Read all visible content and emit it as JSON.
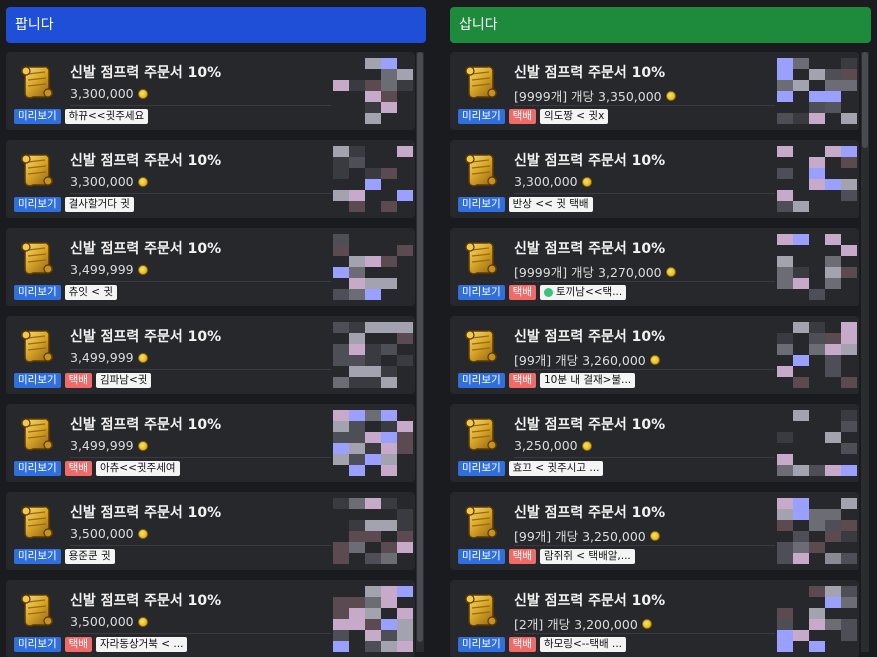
{
  "item_title": "신발 점프력 주문서 10%",
  "preview_label": "미리보기",
  "delivery_label": "택배",
  "sell": {
    "header": "팝니다",
    "listings": [
      {
        "price": "3,300,000",
        "seller": "하뀨<<귓주세요",
        "delivery": false
      },
      {
        "price": "3,300,000",
        "seller": "결사할거다 귓",
        "delivery": false
      },
      {
        "price": "3,499,999",
        "seller": "츄잇 < 귓",
        "delivery": false
      },
      {
        "price": "3,499,999",
        "seller": "김파남<귓",
        "delivery": true
      },
      {
        "price": "3,499,999",
        "seller": "아츄<<귓주세여",
        "delivery": true
      },
      {
        "price": "3,500,000",
        "seller": "용준쿤 귓",
        "delivery": false
      },
      {
        "price": "3,500,000",
        "seller": "자라동상거북 < ...",
        "delivery": true
      }
    ]
  },
  "buy": {
    "header": "삽니다",
    "listings": [
      {
        "price": "[9999개] 개당 3,350,000",
        "seller": "의도짱 < 귓x",
        "delivery": true,
        "gem": false
      },
      {
        "price": "3,300,000",
        "seller": "반상 << 귓 택배",
        "delivery": false,
        "gem": false
      },
      {
        "price": "[9999개] 개당 3,270,000",
        "seller": "토끼남<<택...",
        "delivery": true,
        "gem": true
      },
      {
        "price": "[99개] 개당 3,260,000",
        "seller": "10분 내 결재>불...",
        "delivery": true,
        "gem": false
      },
      {
        "price": "3,250,000",
        "seller": "효끄 < 귓주시고 ...",
        "delivery": false,
        "gem": false
      },
      {
        "price": "[99개] 개당 3,250,000",
        "seller": "람쥐쥐 < 택배알,...",
        "delivery": true,
        "gem": false
      },
      {
        "price": "[2개] 개당 3,200,000",
        "seller": "하모링<--택배 ...",
        "delivery": true,
        "gem": false
      }
    ]
  }
}
